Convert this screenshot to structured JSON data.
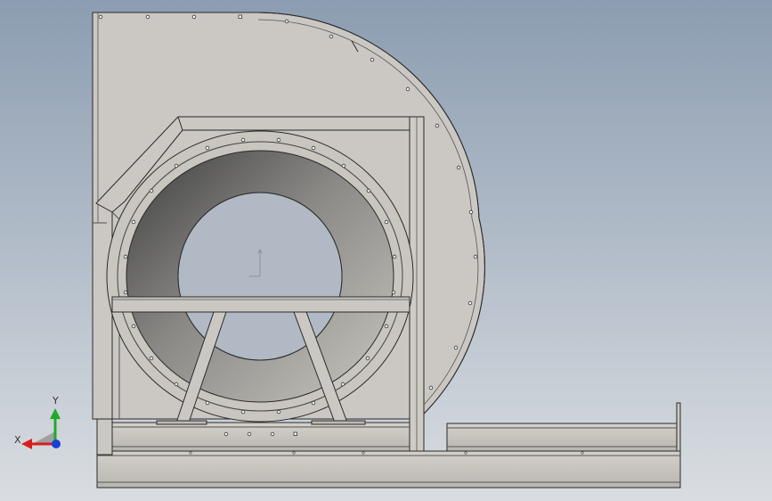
{
  "view": {
    "background_top": "#8c9db1",
    "background_bottom": "#d9dde1",
    "model_name": "centrifugal-fan-assembly",
    "part_fill": "#cbc8c3",
    "part_edge": "#2a2a2a"
  },
  "triad": {
    "x_label": "X",
    "y_label": "Y",
    "x_color": "#d81e1e",
    "y_color": "#1faa2a",
    "z_color": "#1a3fd6",
    "label_color": "#333333"
  }
}
